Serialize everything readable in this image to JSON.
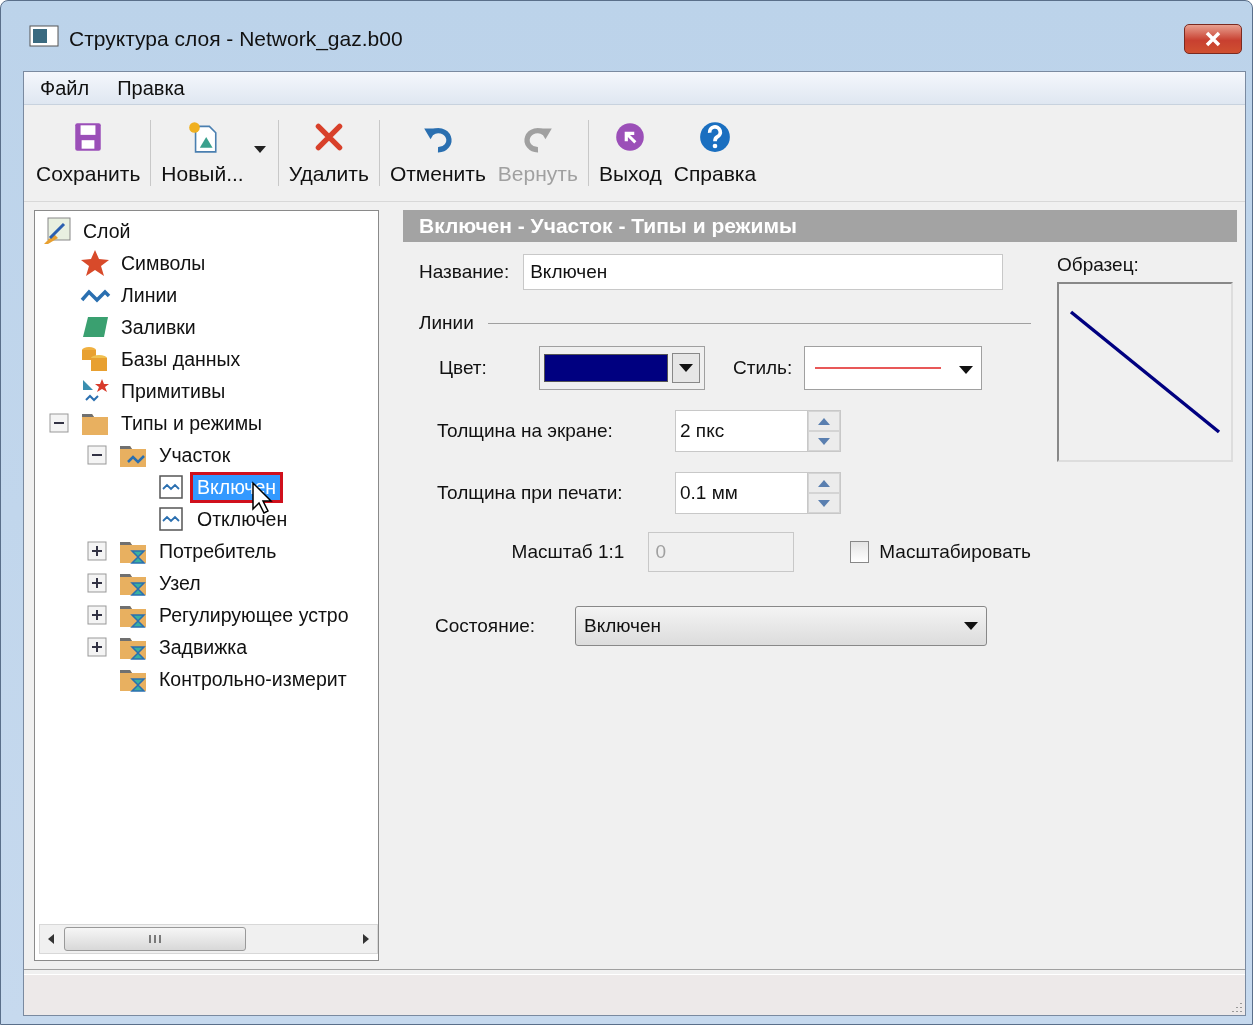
{
  "window": {
    "title": "Структура слоя - Network_gaz.b00"
  },
  "menu": [
    {
      "label": "Файл"
    },
    {
      "label": "Правка"
    }
  ],
  "toolbar": [
    {
      "buttons": [
        {
          "label": "Сохранить",
          "kind": "save",
          "disabled": false,
          "dropdown": false
        }
      ]
    },
    {
      "buttons": [
        {
          "label": "Новый...",
          "kind": "new",
          "disabled": false,
          "dropdown": true
        }
      ]
    },
    {
      "buttons": [
        {
          "label": "Удалить",
          "kind": "delete",
          "disabled": false,
          "dropdown": false
        }
      ]
    },
    {
      "buttons": [
        {
          "label": "Отменить",
          "kind": "undo",
          "disabled": false,
          "dropdown": false
        },
        {
          "label": "Вернуть",
          "kind": "redo",
          "disabled": true,
          "dropdown": false
        }
      ]
    },
    {
      "buttons": [
        {
          "label": "Выход",
          "kind": "exit",
          "disabled": false,
          "dropdown": false
        },
        {
          "label": "Справка",
          "kind": "help",
          "disabled": false,
          "dropdown": false
        }
      ]
    }
  ],
  "tree": [
    {
      "label": "Слой",
      "kind": "layer",
      "selected": false,
      "children": [
        {
          "label": "Символы",
          "kind": "star",
          "selected": false
        },
        {
          "label": "Линии",
          "kind": "wave",
          "selected": false
        },
        {
          "label": "Заливки",
          "kind": "fill",
          "selected": false
        },
        {
          "label": "Базы данных",
          "kind": "database",
          "selected": false
        },
        {
          "label": "Примитивы",
          "kind": "primitives",
          "selected": false
        },
        {
          "label": "Типы и режимы",
          "kind": "folder",
          "selected": false,
          "expanded": true,
          "children": [
            {
              "label": "Участок",
              "kind": "folder-wave",
              "selected": false,
              "expanded": true,
              "children": [
                {
                  "label": "Включен",
                  "kind": "line-item",
                  "selected": true
                },
                {
                  "label": "Отключен",
                  "kind": "line-item",
                  "selected": false
                }
              ]
            },
            {
              "label": "Потребитель",
              "kind": "folder-hourglass",
              "selected": false,
              "expanded": false
            },
            {
              "label": "Узел",
              "kind": "folder-hourglass",
              "selected": false,
              "expanded": false
            },
            {
              "label": "Регулирующее устро",
              "kind": "folder-hourglass",
              "selected": false,
              "expanded": false
            },
            {
              "label": "Задвижка",
              "kind": "folder-hourglass",
              "selected": false,
              "expanded": false
            },
            {
              "label": "Контрольно-измерит",
              "kind": "folder-hourglass",
              "selected": false
            }
          ]
        }
      ]
    }
  ],
  "detail": {
    "heading": "Включен - Участок - Типы и режимы",
    "name_label": "Название:",
    "name_value": "Включен",
    "lines_group": "Линии",
    "color_label": "Цвет:",
    "style_label": "Стиль:",
    "screen_width_label": "Толщина на экране:",
    "screen_width_value": "2 пкс",
    "print_width_label": "Толщина при печати:",
    "print_width_value": "0.1 мм",
    "scale_label": "Масштаб 1:1",
    "scale_value": "0",
    "scale_disabled": true,
    "scale_checkbox": {
      "label": "Масштабировать",
      "checked": false
    },
    "state_label": "Состояние:",
    "state_value": "Включен",
    "sample_label": "Образец:"
  }
}
